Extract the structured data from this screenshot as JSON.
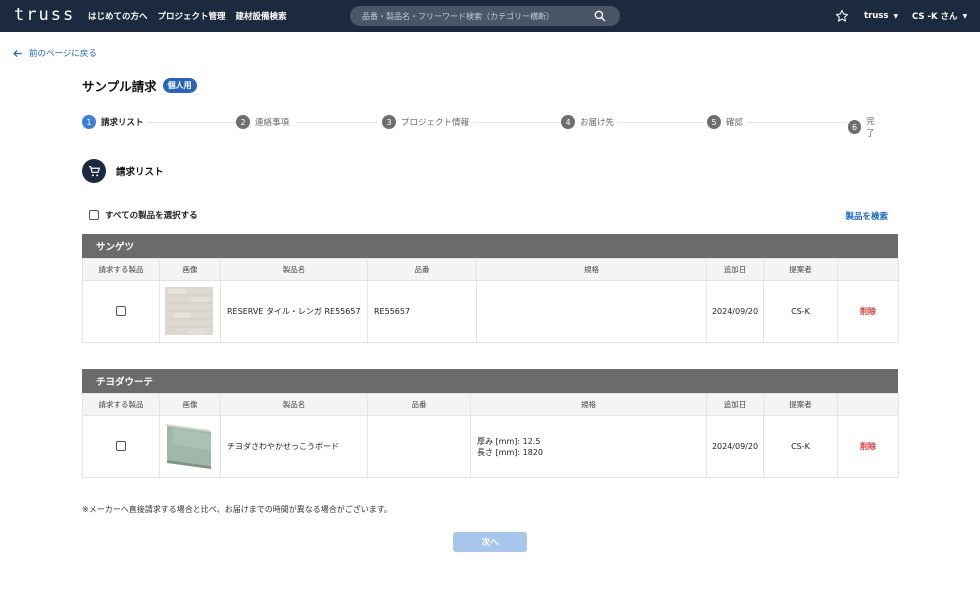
{
  "header": {
    "logo": "truss",
    "nav": [
      "はじめての方へ",
      "プロジェクト管理",
      "建材設備検索"
    ],
    "search_placeholder": "品番・製品名・フリーワード検索（カテゴリー横断）",
    "menu_truss": "truss",
    "user": "CS -K さん"
  },
  "back_link": "前のページに戻る",
  "page_title": "サンプル請求",
  "title_badge": "個人用",
  "steps": [
    {
      "num": "1",
      "label": "請求リスト"
    },
    {
      "num": "2",
      "label": "連絡事項"
    },
    {
      "num": "3",
      "label": "プロジェクト情報"
    },
    {
      "num": "4",
      "label": "お届け先"
    },
    {
      "num": "5",
      "label": "確認"
    },
    {
      "num": "6",
      "label": "完了"
    }
  ],
  "section_title": "請求リスト",
  "select_all_label": "すべての製品を選択する",
  "search_products_link": "製品を検索",
  "columns": [
    "請求する製品",
    "画像",
    "製品名",
    "品番",
    "規格",
    "追加日",
    "提案者",
    ""
  ],
  "groups": [
    {
      "maker": "サンゲツ",
      "rows": [
        {
          "name": "RESERVE タイル・レンガ RE55657",
          "code": "RE55657",
          "spec": [
            "",
            ""
          ],
          "date": "2024/09/20",
          "proposer": "CS-K",
          "delete": "削除"
        }
      ]
    },
    {
      "maker": "チヨダウーテ",
      "rows": [
        {
          "name": "チヨダさわやかせっこうボード",
          "code": "",
          "spec": [
            "厚み [mm]: 12.5",
            "長さ [mm]: 1820"
          ],
          "date": "2024/09/20",
          "proposer": "CS-K",
          "delete": "削除"
        }
      ]
    }
  ],
  "note": "※メーカーへ直接請求する場合と比べ、お届けまでの時間が異なる場合がございます。",
  "next_button": "次へ",
  "colors": {
    "header_bg": "#1c2a3f",
    "accent": "#2a64b8",
    "link": "#1a66c4",
    "delete": "#d63b3b",
    "group_head": "#6b6b6b",
    "next_disabled": "#a8c5ec"
  },
  "icons": [
    "arrow-left-icon",
    "search-icon",
    "star-icon",
    "caret-down-icon",
    "cart-icon"
  ]
}
